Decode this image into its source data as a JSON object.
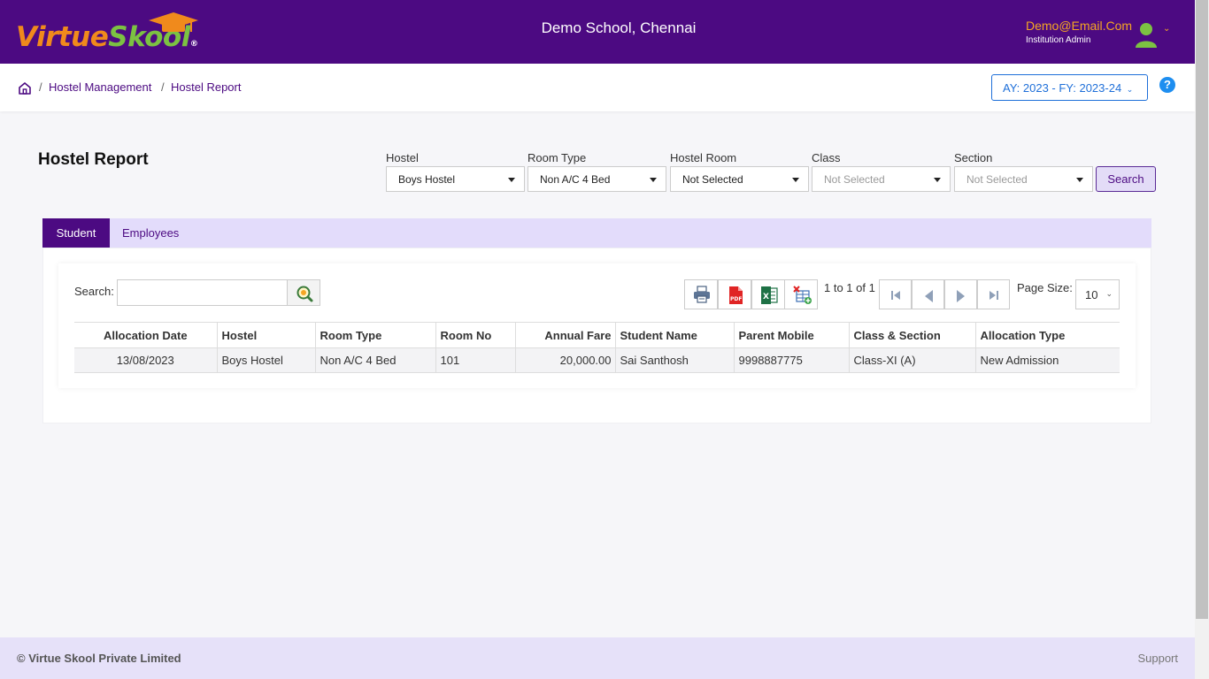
{
  "header": {
    "logo": {
      "part1": "Virtue",
      "part2": "Skool",
      "reg": "®"
    },
    "school": "Demo School, Chennai",
    "user_email": "Demo@Email.Com",
    "user_role": "Institution Admin"
  },
  "breadcrumb": {
    "item1": "Hostel Management",
    "item2": "Hostel Report",
    "separator": "/"
  },
  "academic_year": "AY: 2023 - FY: 2023-24",
  "help": "?",
  "page": {
    "title": "Hostel Report"
  },
  "filters": {
    "hostel": {
      "label": "Hostel",
      "value": "Boys Hostel"
    },
    "room_type": {
      "label": "Room Type",
      "value": "Non A/C 4 Bed"
    },
    "hostel_room": {
      "label": "Hostel Room",
      "value": "Not Selected"
    },
    "class": {
      "label": "Class",
      "value": "Not Selected"
    },
    "section": {
      "label": "Section",
      "value": "Not Selected"
    },
    "search_label": "Search"
  },
  "tabs": {
    "student": "Student",
    "employees": "Employees"
  },
  "grid": {
    "search_label": "Search:",
    "search_value": "",
    "pager_info": "1 to 1 of 1",
    "page_size_label": "Page Size:",
    "page_size": "10",
    "columns": [
      "Allocation Date",
      "Hostel",
      "Room Type",
      "Room No",
      "Annual Fare",
      "Student Name",
      "Parent Mobile",
      "Class & Section",
      "Allocation Type"
    ],
    "rows": [
      [
        "13/08/2023",
        "Boys Hostel",
        "Non A/C 4 Bed",
        "101",
        "20,000.00",
        "Sai Santhosh",
        "9998887775",
        "Class-XI (A)",
        "New Admission"
      ]
    ]
  },
  "footer": {
    "copyright": "© Virtue Skool Private Limited",
    "support": "Support"
  },
  "colors": {
    "brand": "#4c0a82",
    "accent_orange": "#f08a1c",
    "accent_green": "#7cc242",
    "link_blue": "#1e6fd9"
  }
}
